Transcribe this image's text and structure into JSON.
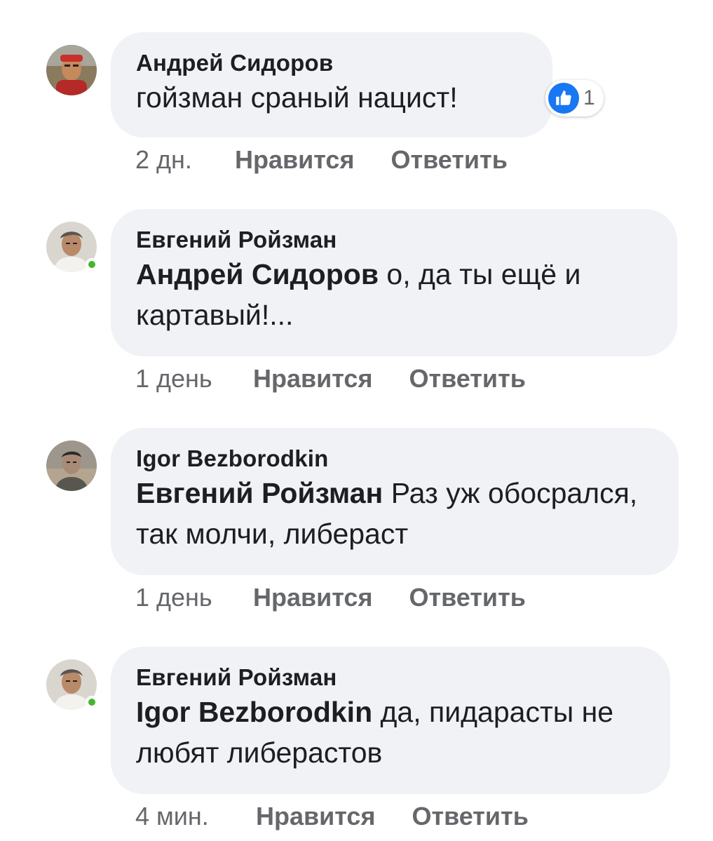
{
  "comments": [
    {
      "author": "Андрей Сидоров",
      "mention": "",
      "text": "гойзман сраный нацист!",
      "time": "2 дн.",
      "like_label": "Нравится",
      "reply_label": "Ответить",
      "reaction": {
        "icon": "like-icon",
        "count": "1",
        "color": "#1877f2"
      },
      "online": false
    },
    {
      "author": "Евгений Ройзман",
      "mention": "Андрей Сидоров",
      "text": " о, да ты ещё и картавый!...",
      "time": "1 день",
      "like_label": "Нравится",
      "reply_label": "Ответить",
      "online": true
    },
    {
      "author": "Igor Bezborodkin",
      "mention": "Евгений Ройзман",
      "text": " Раз уж обосрался, так молчи, либераст",
      "time": "1 день",
      "like_label": "Нравится",
      "reply_label": "Ответить",
      "online": false
    },
    {
      "author": "Евгений Ройзман",
      "mention": "Igor Bezborodkin",
      "text": " да, пидарасты не любят либерастов",
      "time": "4 мин.",
      "like_label": "Нравится",
      "reply_label": "Ответить",
      "online": true
    }
  ],
  "colors": {
    "bubble": "#f0f2f5",
    "meta_text": "#65676b",
    "online_indicator": "#42b72a",
    "like_blue": "#1877f2"
  }
}
